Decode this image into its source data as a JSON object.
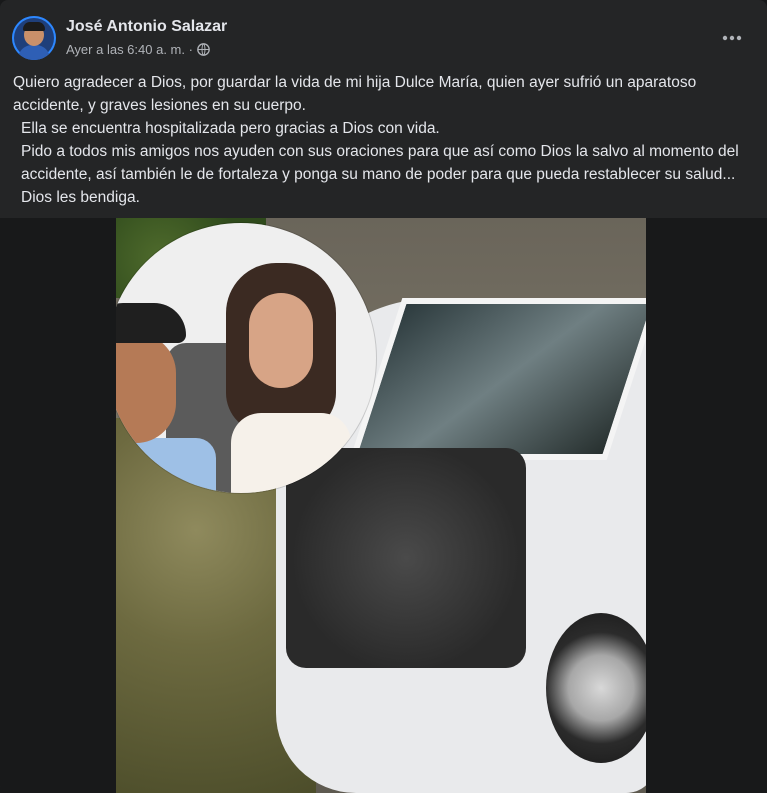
{
  "post": {
    "author": "José Antonio Salazar",
    "timestamp": "Ayer a las 6:40 a. m. ·",
    "privacy_icon": "globe-icon",
    "more_icon": "more-horizontal-icon",
    "text": {
      "p1": "Quiero agradecer a Dios, por guardar la vida de mi hija Dulce María, quien ayer sufrió un aparatoso accidente, y graves lesiones en su cuerpo.",
      "p2": "Ella se encuentra hospitalizada pero gracias a Dios con vida.",
      "p3": "Pido a todos mis amigos nos ayuden con sus oraciones para que así como Dios la salvo al momento del accidente, así también le de fortaleza y ponga su mano de poder para que pueda restablecer su salud... Dios les bendiga."
    }
  },
  "colors": {
    "card_bg": "#242526",
    "page_bg": "#18191a",
    "primary_text": "#e4e6eb",
    "secondary_text": "#b0b3b8",
    "accent": "#2d88ff"
  }
}
